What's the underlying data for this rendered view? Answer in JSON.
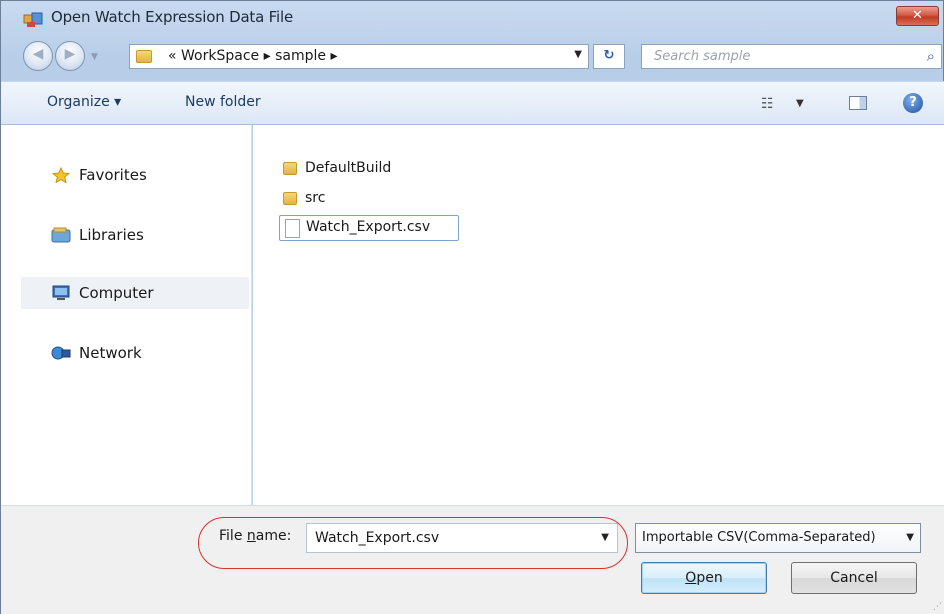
{
  "window": {
    "title": "Open Watch Expression Data File",
    "close_glyph": "✕"
  },
  "navigation": {
    "back_glyph": "◀",
    "forward_glyph": "▶",
    "address": {
      "overflow": "«",
      "segments": [
        "WorkSpace",
        "sample"
      ],
      "separator": "▸"
    },
    "search_placeholder": "Search sample",
    "refresh_glyph": "↻"
  },
  "toolbar": {
    "organize_label": "Organize ▾",
    "new_folder_label": "New folder",
    "view_glyph": "☷",
    "help_glyph": "?"
  },
  "sidebar": {
    "items": [
      {
        "label": "Favorites",
        "icon": "star-icon"
      },
      {
        "label": "Libraries",
        "icon": "library-icon"
      },
      {
        "label": "Computer",
        "icon": "computer-icon"
      },
      {
        "label": "Network",
        "icon": "network-icon"
      }
    ],
    "selected": "Computer"
  },
  "files": [
    {
      "name": "DefaultBuild",
      "type": "folder"
    },
    {
      "name": "src",
      "type": "folder"
    },
    {
      "name": "Watch_Export.csv",
      "type": "file"
    }
  ],
  "footer": {
    "file_name_prefix": "File ",
    "file_name_mnemonic": "n",
    "file_name_suffix": "ame:",
    "file_name_value": "Watch_Export.csv",
    "filter_value": "Importable CSV(Comma-Separated)",
    "open_mnemonic": "O",
    "open_rest": "pen",
    "cancel_label": "Cancel"
  },
  "colors": {
    "accent": "#2c5ba8",
    "highlight_oval": "#d9302a",
    "close_button": "#c23b24"
  }
}
